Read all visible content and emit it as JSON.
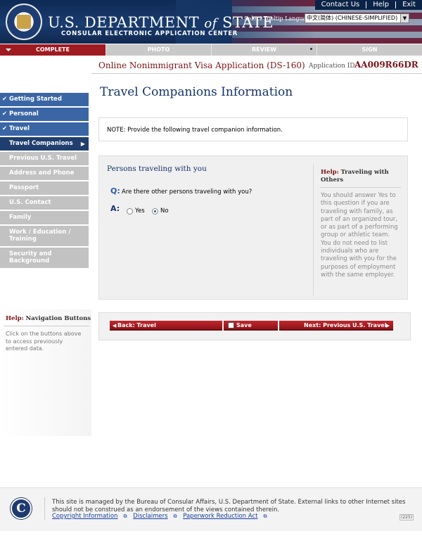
{
  "header": {
    "dept_main": "U.S. DEPARTMENT",
    "dept_of": "of",
    "dept_state": "STATE",
    "subtitle": "CONSULAR ELECTRONIC APPLICATION CENTER",
    "links": [
      "Contact Us",
      "Help",
      "Exit"
    ],
    "language_label": "Select Tooltip Language",
    "language_value": "中文(简体) (CHINESE-SIMPLIFIED)"
  },
  "steps": [
    {
      "label": "COMPLETE",
      "active": true
    },
    {
      "label": "PHOTO",
      "active": false
    },
    {
      "label": "REVIEW",
      "active": false
    },
    {
      "label": "SIGN",
      "active": false
    }
  ],
  "app": {
    "title": "Online Nonimmigrant Visa Application (DS-160)",
    "id_label": "Application ID",
    "id_value": "AA009R66DR"
  },
  "sidebar": {
    "items": [
      {
        "label": "Getting Started",
        "state": "done"
      },
      {
        "label": "Personal",
        "state": "done"
      },
      {
        "label": "Travel",
        "state": "done"
      },
      {
        "label": "Travel Companions",
        "state": "current"
      },
      {
        "label": "Previous U.S. Travel",
        "state": "todo"
      },
      {
        "label": "Address and Phone",
        "state": "todo"
      },
      {
        "label": "Passport",
        "state": "todo"
      },
      {
        "label": "U.S. Contact",
        "state": "todo"
      },
      {
        "label": "Family",
        "state": "todo"
      },
      {
        "label": "Work / Education / Training",
        "state": "todo"
      },
      {
        "label": "Security and Background",
        "state": "todo"
      }
    ],
    "help_title": "Help:",
    "help_topic": "Navigation Buttons",
    "help_text": "Click on the buttons above to access previously entered data."
  },
  "main": {
    "page_title": "Travel Companions Information",
    "note": "NOTE: Provide the following travel companion information.",
    "section_title": "Persons traveling with you",
    "q_label": "Q:",
    "question": "Are there other persons traveling with you?",
    "a_label": "A:",
    "options": [
      "Yes",
      "No"
    ],
    "selected": "No",
    "help_title": "Help:",
    "help_topic": "Traveling with Others",
    "help_text": "You should answer Yes to this question if you are traveling with family, as part of an organized tour, or as part of a performing group or athletic team. You do not need to list individuals who are traveling with you for the purposes of employment with the same employer."
  },
  "nav": {
    "back": "Back: Travel",
    "save": "Save",
    "next": "Next: Previous U.S. Travel"
  },
  "footer": {
    "logo_letter": "C",
    "text": "This site is managed by the Bureau of Consular Affairs, U.S. Department of State. External links to other Internet sites should not be construed as an endorsement of the views contained therein.",
    "links": [
      "Copyright Information",
      "Disclaimers",
      "Paperwork Reduction Act"
    ],
    "code": "(225)"
  },
  "colors": {
    "accent": "#a01a22",
    "navy": "#14326a",
    "sidebar_done": "#3a66a5",
    "sidebar_current": "#213f6e",
    "sidebar_todo": "#c2c2c2"
  }
}
